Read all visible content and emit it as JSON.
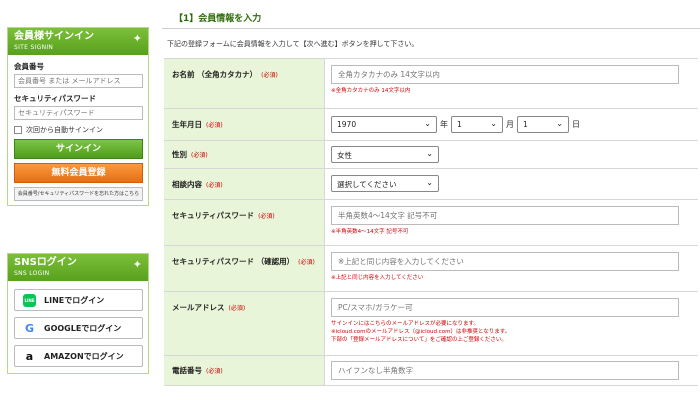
{
  "signin": {
    "title": "会員様サインイン",
    "subtitle": "SITE SIGNIN",
    "member_label": "会員番号",
    "member_placeholder": "会員番号 または メールアドレス",
    "password_label": "セキュリティパスワード",
    "password_placeholder": "セキュリティパスワード",
    "auto_label": "次回から自動サインイン",
    "signin_button": "サインイン",
    "register_button": "無料会員登録",
    "forgot_link": "会員番号/セキュリティパスワードを忘れた方はこちら"
  },
  "sns": {
    "title": "SNSログイン",
    "subtitle": "SNS LOGIN",
    "line": "LINEでログイン",
    "line_icon_text": "LINE",
    "google": "GOOGLEでログイン",
    "amazon": "AMAZONでログイン"
  },
  "icons": {
    "sparkle": "sparkle-icon",
    "line": "line-icon",
    "google": "google-icon",
    "amazon": "amazon-icon",
    "chevron": "chevron-down-icon"
  },
  "colors": {
    "accent_green": "#58a11c",
    "register_orange": "#ea6d0f",
    "label_bg": "#e9f5d8",
    "note_red": "#cc0000"
  },
  "main": {
    "section_title": "【1】会員情報を入力",
    "intro": "下記の登録フォームに会員情報を入力して【次へ進む】ボタンを押して下さい。",
    "required": "(必須)",
    "fields": {
      "name": {
        "label": "お名前 （全角カタカナ）",
        "placeholder": "全角カタカナのみ 14文字以内",
        "note": "※全角カタカナのみ 14文字以内"
      },
      "birth": {
        "label": "生年月日",
        "year": "1970",
        "year_unit": "年",
        "month": "1",
        "month_unit": "月",
        "day": "1",
        "day_unit": "日"
      },
      "gender": {
        "label": "性別",
        "value": "女性"
      },
      "consult": {
        "label": "相談内容",
        "value": "選択してください"
      },
      "password": {
        "label": "セキュリティパスワード",
        "placeholder": "半角英数4～14文字 記号不可",
        "note": "※半角英数4～14文字 記号不可"
      },
      "password_confirm": {
        "label": "セキュリティパスワード （確認用）",
        "placeholder": "※上記と同じ内容を入力してください",
        "note": "※上記と同じ内容を入力してください"
      },
      "email": {
        "label": "メールアドレス",
        "placeholder": "PC/スマホ/ガラケー可",
        "note1": "サインインにはこちらのメールアドレスが必要になります。",
        "note2": "※icloud.comのメールアドレス（@icloud.com）は非推奨となります。",
        "note3": "下部の「登録メールアドレスについて」をご確認の上ご登録ください。"
      },
      "phone": {
        "label": "電話番号",
        "placeholder": "ハイフンなし半角数字"
      }
    }
  }
}
